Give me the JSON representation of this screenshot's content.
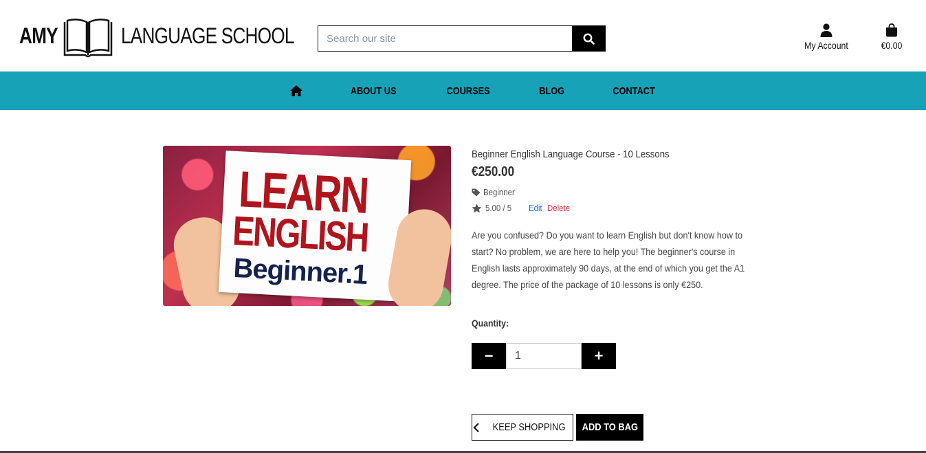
{
  "header": {
    "logo_left": "AMY",
    "logo_right": "LANGUAGE SCHOOL",
    "search_placeholder": "Search our site",
    "search_value": "",
    "account_label": "My Account",
    "bag_total": "€0.00"
  },
  "nav": {
    "items": [
      {
        "label": "ABOUT US"
      },
      {
        "label": "COURSES"
      },
      {
        "label": "BLOG"
      },
      {
        "label": "CONTACT"
      }
    ]
  },
  "product": {
    "image_text": {
      "line1": "LEARN",
      "line2": "ENGLISH",
      "line3": "Beginner.1"
    },
    "name": "Beginner English Language Course - 10 Lessons",
    "price": "€250.00",
    "category": "Beginner",
    "rating": "5.00 / 5",
    "edit_label": "Edit",
    "delete_label": "Delete",
    "description": "Are you confused? Do you want to learn English but don't know how to start? No problem, we are here to help you! The beginner's course in English lasts approximately 90 days, at the end of which you get the A1 degree. The price of the package of 10 lessons is only €250."
  },
  "quantity": {
    "label": "Quantity:",
    "value": "1",
    "decrement": "−",
    "increment": "+"
  },
  "actions": {
    "keep_shopping": "KEEP SHOPPING",
    "add_to_bag": "ADD TO BAG"
  },
  "colors": {
    "nav_bg": "#17a2b8",
    "edit_link": "#1a73e8",
    "delete_link": "#dc3545",
    "button_bg": "#000000"
  },
  "icons": [
    "book-icon",
    "search-icon",
    "user-icon",
    "shopping-bag-icon",
    "home-icon",
    "tag-icon",
    "star-icon",
    "chevron-left-icon"
  ]
}
